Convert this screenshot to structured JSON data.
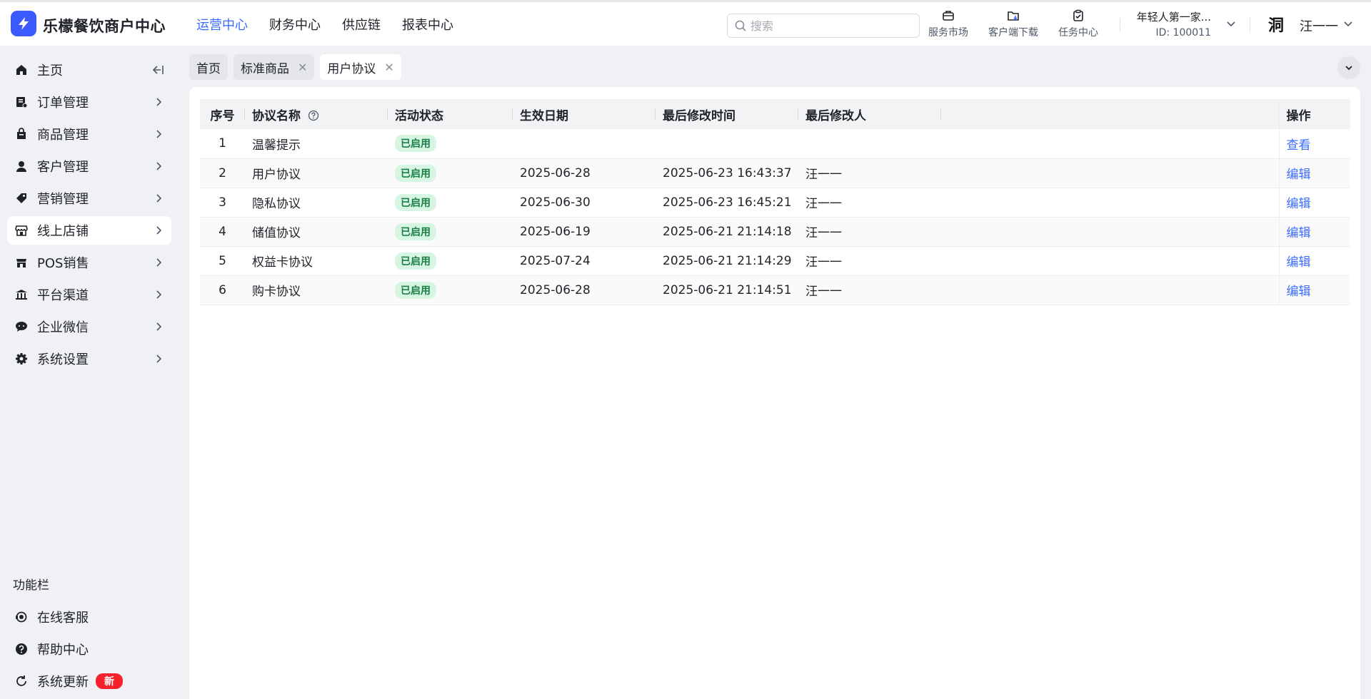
{
  "app": {
    "title": "乐檬餐饮商户中心"
  },
  "topnav": [
    {
      "label": "运营中心",
      "active": true
    },
    {
      "label": "财务中心",
      "active": false
    },
    {
      "label": "供应链",
      "active": false
    },
    {
      "label": "报表中心",
      "active": false
    }
  ],
  "search": {
    "placeholder": "搜索",
    "value": ""
  },
  "tools": [
    {
      "label": "服务市场",
      "icon": "briefcase-icon"
    },
    {
      "label": "客户端下载",
      "icon": "folder-download-icon"
    },
    {
      "label": "任务中心",
      "icon": "clipboard-check-icon"
    }
  ],
  "store": {
    "name": "年轻人第一家...",
    "id": "ID: 100011"
  },
  "user": {
    "name": "汪一一",
    "avatar_text": "洞"
  },
  "sidebar": {
    "items": [
      {
        "label": "主页",
        "icon": "home-icon"
      },
      {
        "label": "订单管理",
        "icon": "order-icon"
      },
      {
        "label": "商品管理",
        "icon": "goods-icon"
      },
      {
        "label": "客户管理",
        "icon": "user-icon"
      },
      {
        "label": "营销管理",
        "icon": "tag-icon"
      },
      {
        "label": "线上店铺",
        "icon": "store-icon"
      },
      {
        "label": "POS销售",
        "icon": "pos-icon"
      },
      {
        "label": "平台渠道",
        "icon": "bank-icon"
      },
      {
        "label": "企业微信",
        "icon": "chat-icon"
      },
      {
        "label": "系统设置",
        "icon": "gear-icon"
      }
    ],
    "section_label": "功能栏",
    "tools": [
      {
        "label": "在线客服",
        "icon": "headset-icon"
      },
      {
        "label": "帮助中心",
        "icon": "help-icon"
      },
      {
        "label": "系统更新",
        "icon": "refresh-icon",
        "badge": "新"
      }
    ]
  },
  "tabs": [
    {
      "label": "首页",
      "closable": false
    },
    {
      "label": "标准商品",
      "closable": true
    },
    {
      "label": "用户协议",
      "closable": true,
      "active": true
    }
  ],
  "table": {
    "columns": [
      "序号",
      "协议名称",
      "活动状态",
      "生效日期",
      "最后修改时间",
      "最后修改人",
      "",
      "操作"
    ],
    "rows": [
      {
        "idx": "1",
        "name": "温馨提示",
        "status": "已启用",
        "date": "",
        "modified": "",
        "modifier": "",
        "op": "查看"
      },
      {
        "idx": "2",
        "name": "用户协议",
        "status": "已启用",
        "date": "2025-06-28",
        "modified": "2025-06-23 16:43:37",
        "modifier": "汪一一",
        "op": "编辑"
      },
      {
        "idx": "3",
        "name": "隐私协议",
        "status": "已启用",
        "date": "2025-06-30",
        "modified": "2025-06-23 16:45:21",
        "modifier": "汪一一",
        "op": "编辑"
      },
      {
        "idx": "4",
        "name": "储值协议",
        "status": "已启用",
        "date": "2025-06-19",
        "modified": "2025-06-21 21:14:18",
        "modifier": "汪一一",
        "op": "编辑"
      },
      {
        "idx": "5",
        "name": "权益卡协议",
        "status": "已启用",
        "date": "2025-07-24",
        "modified": "2025-06-21 21:14:29",
        "modifier": "汪一一",
        "op": "编辑"
      },
      {
        "idx": "6",
        "name": "购卡协议",
        "status": "已启用",
        "date": "2025-06-28",
        "modified": "2025-06-21 21:14:51",
        "modifier": "汪一一",
        "op": "编辑"
      }
    ]
  },
  "colors": {
    "accent": "#3b6cff",
    "logo": "#3b5bff",
    "status_bg": "#d6f5e3",
    "status_fg": "#1b7f47",
    "badge": "#f5222d"
  }
}
